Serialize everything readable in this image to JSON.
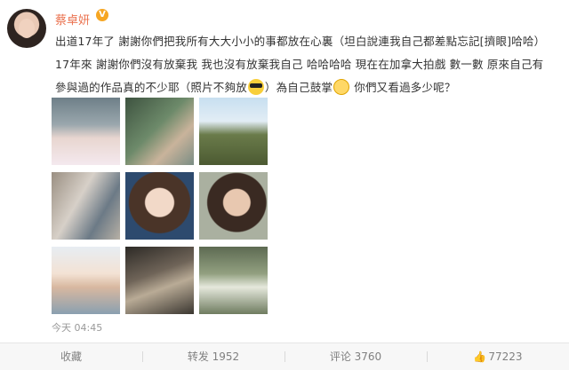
{
  "user": {
    "name": "蔡卓妍",
    "verified_badge": "V"
  },
  "post": {
    "lines": [
      "出道17年了 謝謝你們把我所有大大小小的事都放在心裏（坦白說連我自己都差點忘記[擠眼]哈哈）",
      "17年來 謝謝你們沒有放棄我 我也沒有放棄我自己 哈哈哈哈 現在在加拿大拍戲 數一數 原來自己有",
      "參與過的作品真的不少耶（照片不夠放",
      "）為自己鼓掌",
      " 你們又看過多少呢？"
    ],
    "time": "今天 04:45",
    "photos": [
      "photo-1",
      "photo-2",
      "photo-3",
      "photo-4",
      "photo-5",
      "photo-6",
      "photo-7",
      "photo-8",
      "photo-9"
    ]
  },
  "actions": {
    "favorite": "收藏",
    "repost": "转发 1952",
    "comment": "评论 3760",
    "like": "77223",
    "like_icon": "thumbs-up-icon"
  },
  "colors": {
    "username": "#eb7350",
    "badge": "#f6a623",
    "muted": "#999999"
  }
}
